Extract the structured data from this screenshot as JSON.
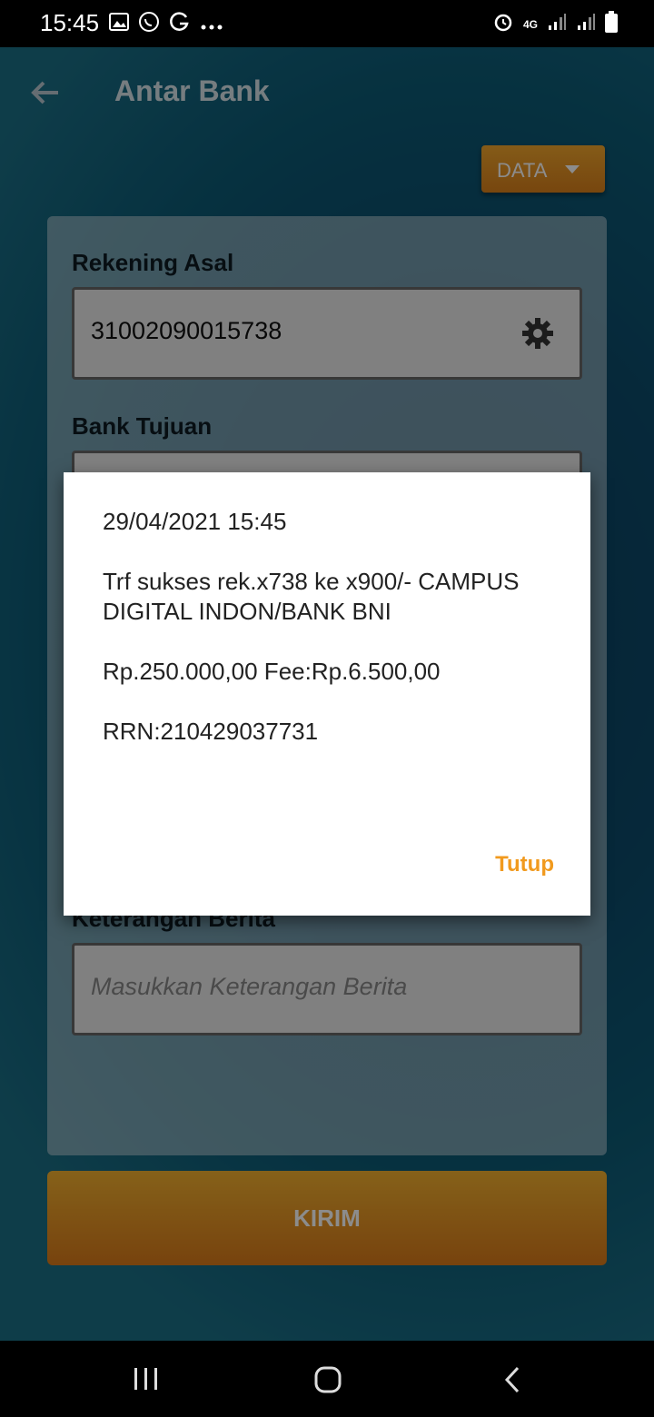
{
  "status_bar": {
    "time": "15:45",
    "left_icons": [
      "gallery-icon",
      "whatsapp-icon",
      "g-icon",
      "more-icon"
    ],
    "right_icons": [
      "alarm-icon",
      "network-4g-icon",
      "signal-icon",
      "signal-icon",
      "battery-icon"
    ],
    "network_label": "4G"
  },
  "appbar": {
    "title": "Antar Bank",
    "back_icon": "back-arrow-icon"
  },
  "data_button": {
    "label": "DATA"
  },
  "form": {
    "source_account": {
      "label": "Rekening Asal",
      "value": "31002090015738"
    },
    "target_bank": {
      "label": "Bank Tujuan"
    },
    "note": {
      "label": "Keterangan Berita",
      "placeholder": "Masukkan Keterangan Berita"
    }
  },
  "submit_button": {
    "label": "KIRIM"
  },
  "dialog": {
    "datetime": "29/04/2021 15:45",
    "message": "Trf sukses rek.x738 ke x900/- CAMPUS DIGITAL INDON/BANK BNI",
    "amount": "Rp.250.000,00 Fee:Rp.6.500,00",
    "rrn": "RRN:210429037731",
    "close_label": "Tutup"
  },
  "colors": {
    "accent": "#f19a1e",
    "background": "#0b4a6a"
  }
}
